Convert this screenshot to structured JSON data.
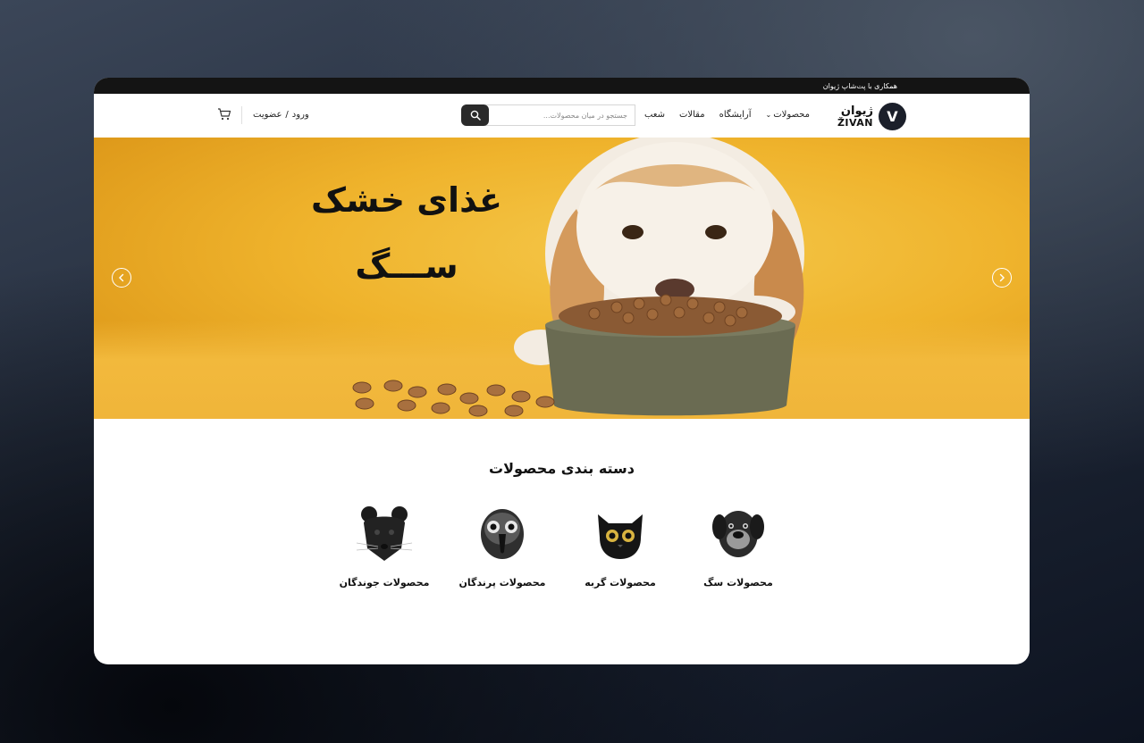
{
  "topbar": {
    "text": "همکاری با پت‌شاپ ژیوان"
  },
  "logo": {
    "name_fa": "ژیوان",
    "name_en": "ŽIVAN",
    "mark": "V"
  },
  "nav": {
    "items": [
      {
        "label": "محصولات",
        "has_dropdown": true
      },
      {
        "label": "آرایشگاه"
      },
      {
        "label": "مقالات"
      },
      {
        "label": "شعب"
      }
    ]
  },
  "search": {
    "placeholder": "جستجو در میان محصولات...",
    "icon": "search-icon"
  },
  "auth": {
    "login": "ورود",
    "separator": "/",
    "register": "عضویت"
  },
  "cart": {
    "icon": "cart-icon"
  },
  "banner": {
    "title_line1": "غذای خشک",
    "title_line2": "ســـگ",
    "prev_icon": "chevron-left-icon",
    "next_icon": "chevron-right-icon",
    "background_color": "#efb32c"
  },
  "categories": {
    "title": "دسته بندی محصولات",
    "items": [
      {
        "label": "محصولات سگ",
        "icon": "dog-icon"
      },
      {
        "label": "محصولات گربه",
        "icon": "cat-icon"
      },
      {
        "label": "محصولات پرندگان",
        "icon": "bird-icon"
      },
      {
        "label": "محصولات جوندگان",
        "icon": "rodent-icon"
      }
    ]
  }
}
